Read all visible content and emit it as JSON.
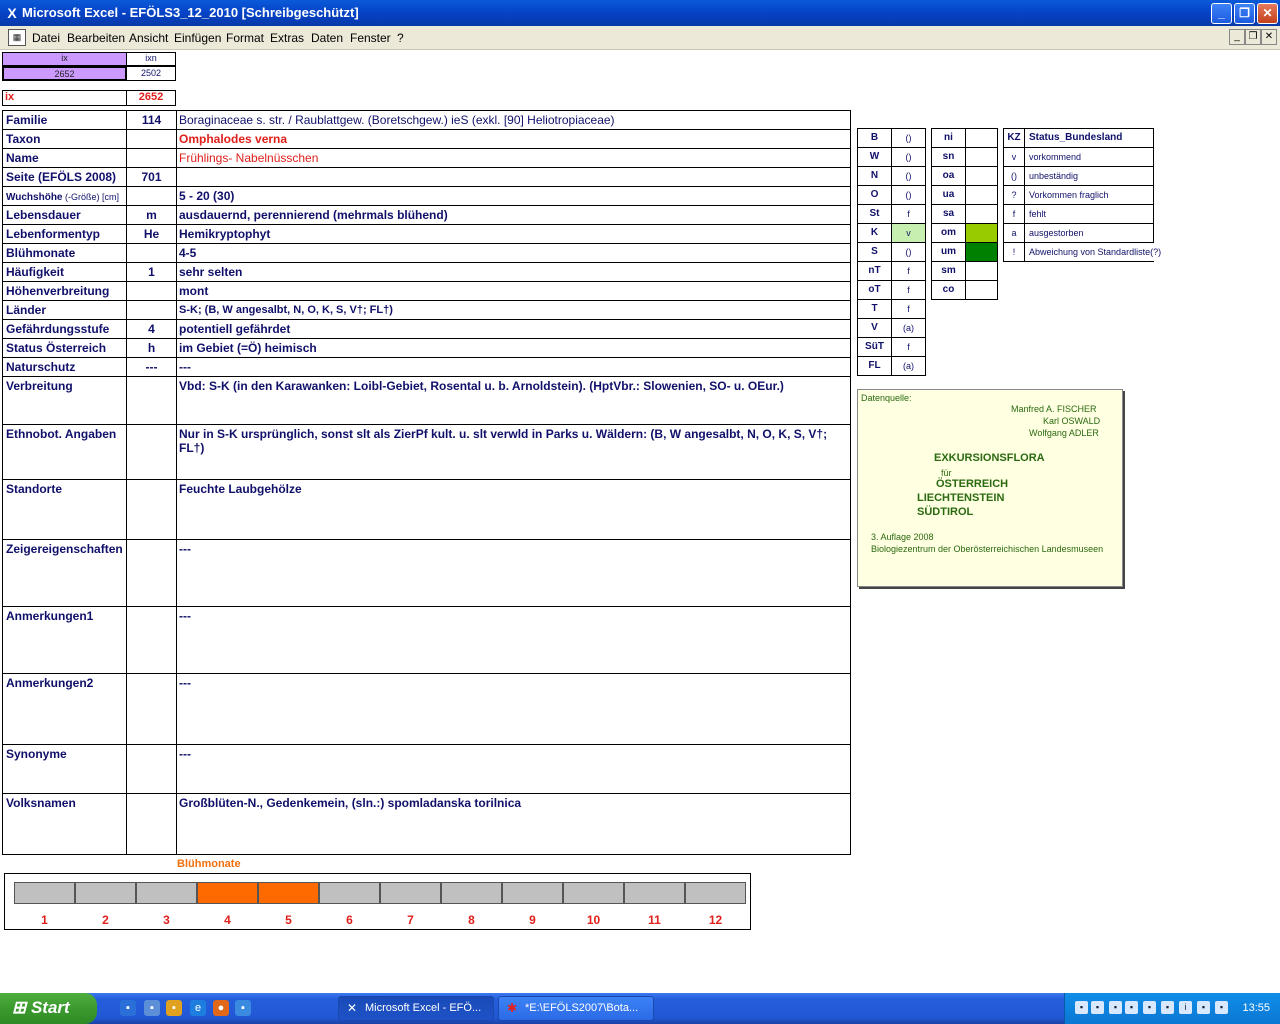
{
  "window": {
    "title": "Microsoft Excel - EFÖLS3_12_2010  [Schreibgeschützt]",
    "minimize_glyph": "_",
    "restore_glyph": "❐",
    "close_glyph": "✕",
    "app_icon": "excel-icon",
    "app_glyph": "X"
  },
  "menu": {
    "doc_glyph": "▦",
    "items": [
      "Datei",
      "Bearbeiten",
      "Ansicht",
      "Einfügen",
      "Format",
      "Extras",
      "Daten",
      "Fenster",
      "?"
    ],
    "mdi_min": "_",
    "mdi_restore": "❐",
    "mdi_close": "✕"
  },
  "header": {
    "ix_label": "ix",
    "ixn_label": "ixn",
    "ix_val": "2652",
    "ixn_val": "2502",
    "ix_red_label": "ix",
    "ix_red_val": "2652"
  },
  "record": [
    {
      "label": "Familie",
      "code": "114",
      "value": "Boraginaceae s. str.  /  Raublattgew. (Boretschgew.) ieS (exkl. [90] Heliotropiaceae)"
    },
    {
      "label": "Taxon",
      "code": "",
      "value": "Omphalodes verna"
    },
    {
      "label": "Name",
      "code": "",
      "value": "Frühlings- Nabelnüsschen"
    },
    {
      "label": "Seite (EFÖLS 2008)",
      "code": "701",
      "value": ""
    },
    {
      "label": "Wuchshöhe",
      "label_small": " (-Größe) [cm]",
      "code": "",
      "value": "5 - 20 (30)"
    },
    {
      "label": "Lebensdauer",
      "code": "m",
      "value": "ausdauernd, perennierend (mehrmals blühend)"
    },
    {
      "label": "Lebenformentyp",
      "code": "He",
      "value": "Hemikryptophyt"
    },
    {
      "label": "Blühmonate",
      "code": "",
      "value": "4-5"
    },
    {
      "label": "Häufigkeit",
      "code": "1",
      "value": "sehr selten"
    },
    {
      "label": "Höhenverbreitung",
      "code": "",
      "value": "mont"
    },
    {
      "label": "Länder",
      "code": "",
      "value": "S-K; (B, W angesalbt, N, O, K, S, V†; FL†)"
    },
    {
      "label": "Gefährdungsstufe",
      "code": "4",
      "value": "potentiell gefährdet"
    },
    {
      "label": "Status Österreich",
      "code": "h",
      "value": "im Gebiet (=Ö) heimisch"
    },
    {
      "label": "Naturschutz",
      "code": "---",
      "value": "---"
    },
    {
      "label": "Verbreitung",
      "code": "",
      "value": "Vbd: S-K (in den Karawanken: Loibl-Gebiet, Rosental u. b. Arnoldstein). (HptVbr.: Slowenien, SO- u. OEur.)"
    },
    {
      "label": "Ethnobot. Angaben",
      "code": "",
      "value": "Nur in S-K ursprünglich, sonst slt als ZierPf kult. u. slt verwld in Parks u. Wäldern: (B, W angesalbt, N, O, K, S, V†; FL†)"
    },
    {
      "label": "Standorte",
      "code": "",
      "value": "Feuchte Laubgehölze"
    },
    {
      "label": "Zeigereigenschaften",
      "code": "",
      "value": "---"
    },
    {
      "label": "Anmerkungen1",
      "code": "",
      "value": "---"
    },
    {
      "label": "Anmerkungen2",
      "code": "",
      "value": "---"
    },
    {
      "label": "Synonyme",
      "code": "",
      "value": "---"
    },
    {
      "label": "Volksnamen",
      "code": "",
      "value": "Großblüten-N., Gedenkemein,   (sln.:) spomladanska torilnica"
    }
  ],
  "states1": [
    [
      "B",
      "()"
    ],
    [
      "W",
      "()"
    ],
    [
      "N",
      "()"
    ],
    [
      "O",
      "()"
    ],
    [
      "St",
      "f"
    ],
    [
      "K",
      "v"
    ],
    [
      "S",
      "()"
    ],
    [
      "nT",
      "f"
    ],
    [
      "oT",
      "f"
    ],
    [
      "T",
      "f"
    ],
    [
      "V",
      "(a)"
    ],
    [
      "SüT",
      "f"
    ],
    [
      "FL",
      "(a)"
    ]
  ],
  "states2": [
    [
      "ni",
      ""
    ],
    [
      "sn",
      ""
    ],
    [
      "oa",
      ""
    ],
    [
      "ua",
      ""
    ],
    [
      "sa",
      ""
    ],
    [
      "om",
      ""
    ],
    [
      "um",
      ""
    ],
    [
      "sm",
      ""
    ],
    [
      "co",
      ""
    ]
  ],
  "legend": {
    "kz": "KZ",
    "title": "Status_Bundesland",
    "items": [
      [
        "v",
        "vorkommend"
      ],
      [
        "()",
        "unbeständig"
      ],
      [
        "?",
        "Vorkommen fraglich"
      ],
      [
        "f",
        "fehlt"
      ],
      [
        "a",
        "ausgestorben"
      ],
      [
        "!",
        "Abweichung von Standardliste(?)"
      ]
    ]
  },
  "colors": {
    "k_value_bg": "#c6efb0",
    "om_bg": "#99cc00",
    "um_bg": "#008000",
    "month_on": "#ff6a00",
    "month_off": "#c0c0c0"
  },
  "source": {
    "label": "Datenquelle:",
    "authors": [
      "Manfred A. FISCHER",
      "Karl OSWALD",
      "Wolfgang ADLER"
    ],
    "title": "EXKURSIONSFLORA",
    "fuer": "für",
    "countries": [
      "ÖSTERREICH",
      "LIECHTENSTEIN",
      "SÜDTIROL"
    ],
    "edition": "3. Auflage 2008",
    "publisher": "Biologiezentrum der Oberösterreichischen Landesmuseen"
  },
  "bluehmonate": {
    "title": "Blühmonate",
    "months": [
      "1",
      "2",
      "3",
      "4",
      "5",
      "6",
      "7",
      "8",
      "9",
      "10",
      "11",
      "12"
    ],
    "flowering": [
      4,
      5
    ]
  },
  "taskbar": {
    "start": "Start",
    "tasks": [
      "Microsoft Excel - EFÖ...",
      "*E:\\EFÖLS2007\\Bota..."
    ],
    "clock": "13:55"
  }
}
